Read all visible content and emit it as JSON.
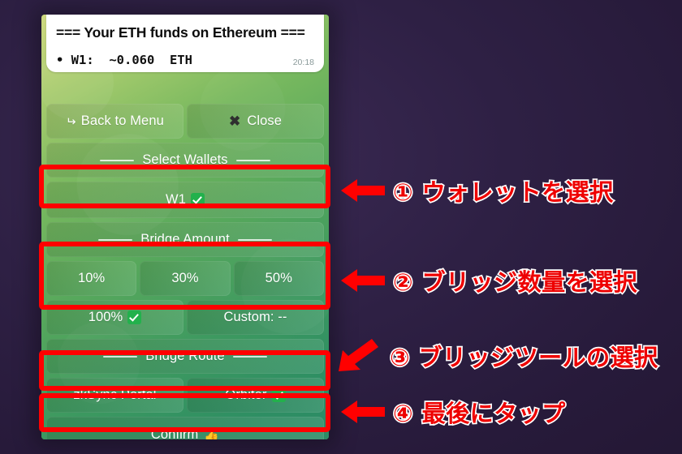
{
  "theme": {
    "backdrop": "#2b1d3f",
    "highlight": "#ff0000",
    "annotation_text": "#ee0000",
    "annotation_outline": "#ffffff",
    "wallpaper_start": "#cfd980",
    "wallpaper_end": "#2b8b66"
  },
  "message": {
    "title": "=== Your ETH funds on Ethereum ===",
    "line1": "• W1:  ~0.060  ETH",
    "time": "20:18"
  },
  "keyboard": {
    "row_nav": [
      {
        "label": "Back to Menu",
        "icon": "back-arrow-icon"
      },
      {
        "label": "Close",
        "icon": "close-x-icon"
      }
    ],
    "section_wallets": "Select Wallets",
    "wallets": [
      {
        "label": "W1",
        "selected": true
      }
    ],
    "section_amount": "Bridge Amount",
    "amounts_row1": [
      {
        "label": "10%",
        "selected": false
      },
      {
        "label": "30%",
        "selected": false
      },
      {
        "label": "50%",
        "selected": false
      }
    ],
    "amounts_row2": [
      {
        "label": "100%",
        "selected": true
      },
      {
        "label": "Custom: --",
        "selected": false
      }
    ],
    "section_route": "Bridge Route",
    "routes": [
      {
        "label": "zkSync Portal",
        "selected": false
      },
      {
        "label": "Orbiter",
        "selected": true
      }
    ],
    "confirm": {
      "label": "Confirm",
      "icon": "thumbs-up-icon"
    }
  },
  "annotations": [
    {
      "id": "step-1",
      "text": "① ウォレットを選択",
      "arrow": "left"
    },
    {
      "id": "step-2",
      "text": "② ブリッジ数量を選択",
      "arrow": "left"
    },
    {
      "id": "step-3",
      "text": "③ ブリッジツールの選択",
      "arrow": "down-left"
    },
    {
      "id": "step-4",
      "text": "④ 最後にタップ",
      "arrow": "left"
    }
  ]
}
